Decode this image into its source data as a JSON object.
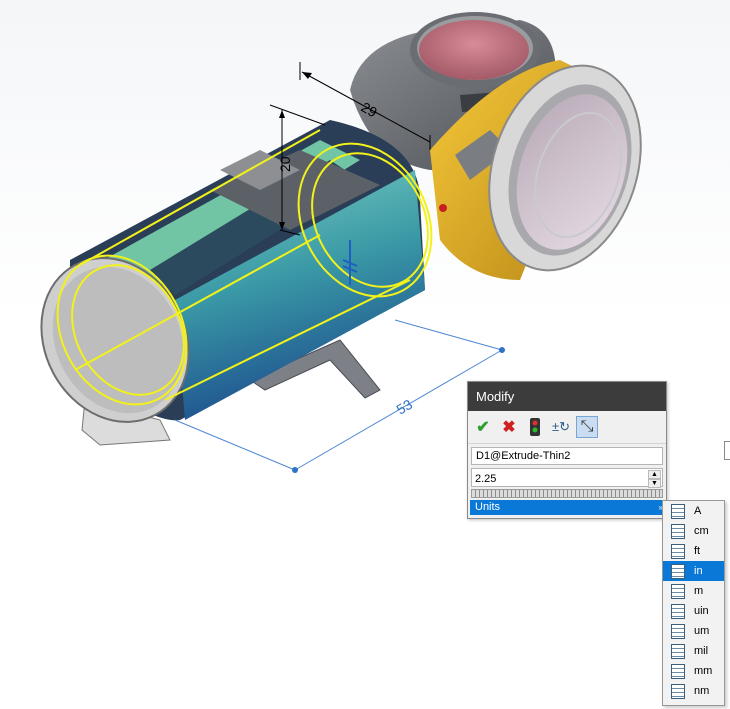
{
  "modify_dialog": {
    "title": "Modify",
    "toolbar": [
      {
        "name": "ok-check-icon",
        "glyph": "✔",
        "color": "#2e9e2e"
      },
      {
        "name": "cancel-x-icon",
        "glyph": "✖",
        "color": "#d02020"
      },
      {
        "name": "rebuild-icon",
        "glyph": "⏺",
        "color": "#c03030"
      },
      {
        "name": "reverse-sense-icon",
        "glyph": "±",
        "color": "#2a5a8a"
      },
      {
        "name": "mark-dimension-icon",
        "glyph": "⤡",
        "color": "#333333"
      }
    ],
    "dimension_name": "D1@Extrude-Thin2",
    "value": "2.25",
    "units_label": "Units",
    "units_arrow": "»"
  },
  "units_menu": {
    "items": [
      "A",
      "cm",
      "ft",
      "in",
      "m",
      "uin",
      "um",
      "mil",
      "mm",
      "nm"
    ],
    "selected": "in"
  },
  "dimensions": {
    "length": "53",
    "height": "20",
    "depth": "29"
  },
  "colors": {
    "selection_yellow": "#f2f21a",
    "dimension_blue": "#2f73c8",
    "menu_highlight": "#0a78d7",
    "dialog_title_bg": "#3c3c3c"
  }
}
